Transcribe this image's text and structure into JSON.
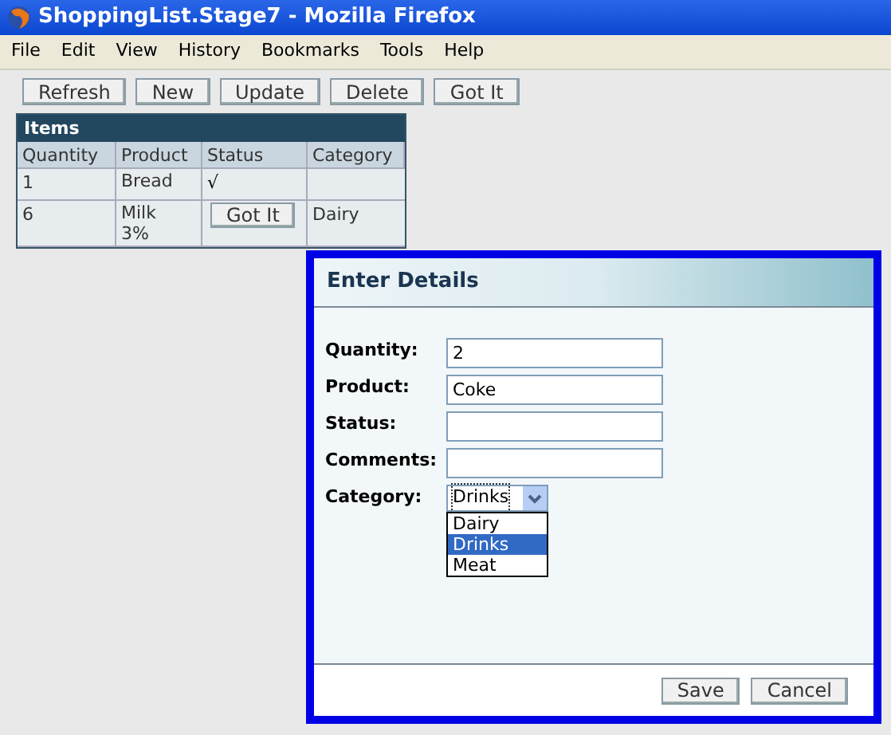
{
  "window": {
    "title": "ShoppingList.Stage7 - Mozilla Firefox"
  },
  "menu": [
    "File",
    "Edit",
    "View",
    "History",
    "Bookmarks",
    "Tools",
    "Help"
  ],
  "toolbar": [
    "Refresh",
    "New",
    "Update",
    "Delete",
    "Got It"
  ],
  "table": {
    "title": "Items",
    "columns": [
      "Quantity",
      "Product",
      "Status",
      "Category"
    ],
    "rows": [
      {
        "quantity": "1",
        "product": "Bread",
        "status": {
          "kind": "text",
          "text": "√"
        }
      },
      {
        "quantity": "6",
        "product": "Milk 3%",
        "status": {
          "kind": "button",
          "text": "Got It"
        },
        "category": "Dairy"
      }
    ]
  },
  "dialog": {
    "title": "Enter Details",
    "fields": [
      {
        "label": "Quantity:",
        "value": "2"
      },
      {
        "label": "Product:",
        "value": "Coke"
      },
      {
        "label": "Status:"
      },
      {
        "label": "Comments:"
      }
    ],
    "category": {
      "label": "Category:",
      "value": "Drinks",
      "expanded": true,
      "options": [
        {
          "label": "Dairy",
          "selected": false
        },
        {
          "label": "Drinks",
          "selected": true
        },
        {
          "label": "Meat",
          "selected": false
        }
      ]
    },
    "buttons": [
      "Save",
      "Cancel"
    ]
  }
}
